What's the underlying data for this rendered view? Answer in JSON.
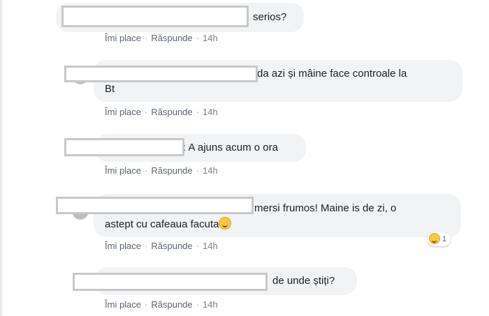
{
  "actions": {
    "like": "Îmi place",
    "reply": "Răspunde",
    "sep": "·"
  },
  "comments": [
    {
      "text": "serios?",
      "time": "14h"
    },
    {
      "text_line1": "da azi și mâine face controale la",
      "text_line2": "Bt",
      "time": "14h"
    },
    {
      "text": ": A ajuns acum o ora",
      "time": "14h"
    },
    {
      "text_line1": "mersi frumos! Maine is de zi, o",
      "text_line2": "astept cu cafeaua facuta",
      "time": "14h",
      "reaction_count": "1"
    },
    {
      "text": "de unde știți?",
      "time": "14h"
    }
  ],
  "icons": {
    "emoji": "laughing-face-icon",
    "reaction": "haha-reaction-icon"
  },
  "colors": {
    "bubble": "#f2f3f5",
    "text": "#1c1e21",
    "meta": "#7a7f87",
    "redaction_border": "#c8c8c8"
  }
}
